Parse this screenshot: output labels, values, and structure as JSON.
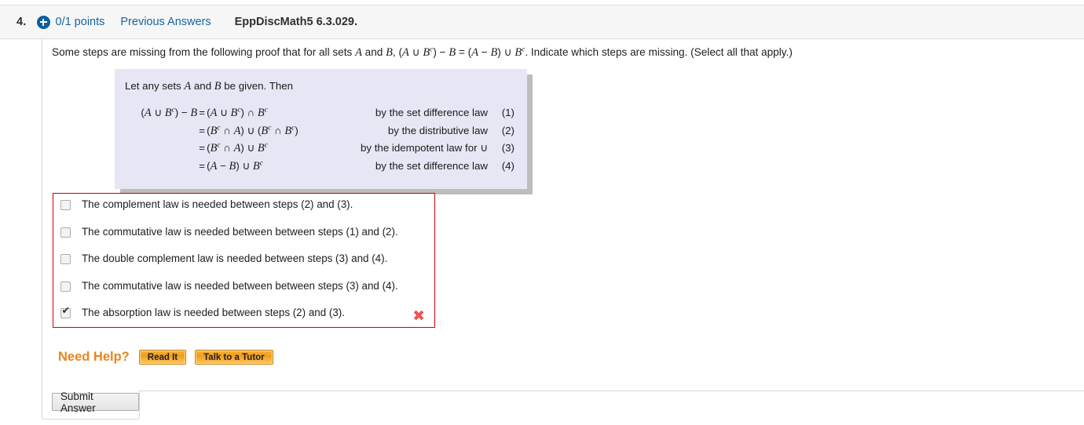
{
  "header": {
    "question_number": "4.",
    "plus_icon": "plus-circle-icon",
    "points": "0/1 points",
    "previous_answers": "Previous Answers",
    "book_reference": "EppDiscMath5 6.3.029.",
    "background": "#f6f6f6",
    "link_color": "#1565a0",
    "icon_color": "#0c5f9e"
  },
  "question": {
    "stem_part1": "Some steps are missing from the following proof that for all sets ",
    "stem_A1": "A",
    "stem_and": " and ",
    "stem_B1": "B",
    "stem_comma": ", (",
    "stem_A2": "A",
    "stem_union1": " ∪ ",
    "stem_B2": "B",
    "stem_sup1": "c",
    "stem_minus1": ") − ",
    "stem_B3": "B",
    "stem_eq": " = (",
    "stem_A3": "A",
    "stem_minus2": " − ",
    "stem_B4": "B",
    "stem_union2": ") ∪ ",
    "stem_B5": "B",
    "stem_sup2": "c",
    "stem_part2": ". Indicate which steps are missing. (Select all that apply.)"
  },
  "proof": {
    "background": "#e6e6f5",
    "lead_part1": "Let any sets ",
    "lead_A": "A",
    "lead_and": " and ",
    "lead_B": "B",
    "lead_part2": " be given. Then",
    "rows": [
      {
        "lhs_html": "lhs-expression",
        "eq": "=",
        "reason": "by the set difference law",
        "step": "(1)"
      },
      {
        "lhs_html": "",
        "eq": "=",
        "reason": "by the distributive law",
        "step": "(2)"
      },
      {
        "lhs_html": "",
        "eq": "=",
        "reason": "by the idempotent law for ∪",
        "step": "(3)"
      },
      {
        "lhs_html": "",
        "eq": "=",
        "reason": "by the set difference law",
        "step": "(4)"
      }
    ]
  },
  "answers": {
    "border_color": "#cc0000",
    "result_mark": "✖",
    "result_mark_color": "#ef5350",
    "choices": [
      {
        "label": "The complement law is needed between steps (2) and (3).",
        "checked": false
      },
      {
        "label": "The commutative law is needed between between steps (1) and (2).",
        "checked": false
      },
      {
        "label": "The double complement law is needed between steps (3) and (4).",
        "checked": false
      },
      {
        "label": "The commutative law is needed between between steps (3) and (4).",
        "checked": false
      },
      {
        "label": "The absorption law is needed between steps (2) and (3).",
        "checked": true
      }
    ]
  },
  "help": {
    "label": "Need Help?",
    "label_color": "#e8861b",
    "read_it": "Read It",
    "talk_to_tutor": "Talk to a Tutor"
  },
  "submit": {
    "label": "Submit Answer"
  }
}
